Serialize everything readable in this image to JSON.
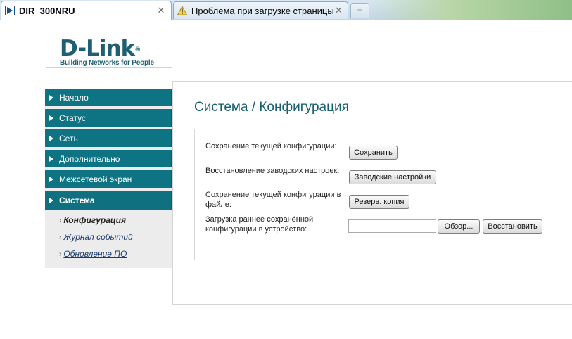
{
  "browser": {
    "tabs": [
      {
        "title": "DIR_300NRU",
        "active": true,
        "icon": "dlink-favicon-icon",
        "close": "✕"
      },
      {
        "title": "Проблема при загрузке страницы",
        "active": false,
        "icon": "warning-icon",
        "close": "✕"
      }
    ],
    "new_tab_glyph": "+"
  },
  "logo": {
    "brand": "D-Link",
    "trademark": "®",
    "tagline": "Building Networks for People",
    "color": "#1f5f73"
  },
  "sidebar": {
    "accent": "#0e7383",
    "items": [
      {
        "label": "Начало"
      },
      {
        "label": "Статус"
      },
      {
        "label": "Сеть"
      },
      {
        "label": "Дополнительно"
      },
      {
        "label": "Межсетевой экран"
      },
      {
        "label": "Система",
        "active": true
      }
    ],
    "subitems": [
      {
        "label": "Конфигурация",
        "current": true
      },
      {
        "label": "Журнал событий"
      },
      {
        "label": "Обновление ПО"
      }
    ]
  },
  "main": {
    "title": "Система / Конфигурация",
    "rows": [
      {
        "label": "Сохранение текущей конфигурации:",
        "button": "Сохранить"
      },
      {
        "label": "Восстановление заводских настроек:",
        "button": "Заводские настройки"
      },
      {
        "label_line1": "Сохранение текущей конфигурации в",
        "label_line2": "файле:",
        "button": "Резерв. копия"
      },
      {
        "label_line1": "Загрузка раннее сохранённой",
        "label_line2": "конфигурации в устройство:",
        "file_value": "",
        "browse_button": "Обзор...",
        "button": "Восстановить"
      }
    ]
  }
}
